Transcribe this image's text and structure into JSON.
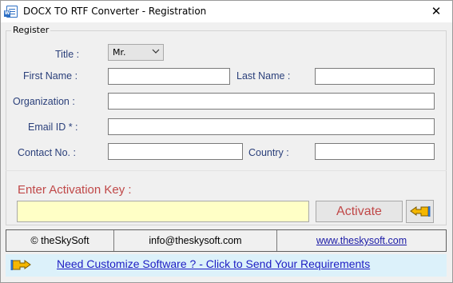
{
  "window": {
    "title": "DOCX TO RTF Converter - Registration",
    "close_glyph": "✕"
  },
  "register": {
    "group_label": "Register",
    "title_label": "Title :",
    "title_value": "Mr.",
    "first_name_label": "First Name :",
    "last_name_label": "Last Name :",
    "organization_label": "Organization :",
    "email_label": "Email ID * :",
    "contact_label": "Contact No. :",
    "country_label": "Country :",
    "first_name_value": "",
    "last_name_value": "",
    "organization_value": "",
    "email_value": "",
    "contact_value": "",
    "country_value": ""
  },
  "activation": {
    "label": "Enter Activation Key  :",
    "key_value": "",
    "button_label": "Activate",
    "back_icon": "hand-pointing-left-icon"
  },
  "footer": {
    "company": "© theSkySoft",
    "email": "info@theskysoft.com",
    "website": "www.theskysoft.com"
  },
  "bottom": {
    "link_text": "Need Customize Software ? - Click to Send Your Requirements",
    "icon": "hand-pointing-right-icon"
  },
  "colors": {
    "label_blue": "#2a3f7a",
    "activation_red": "#c04848",
    "key_input_bg": "#ffffc6",
    "bottom_bar_bg": "#dcf1fa",
    "link_blue": "#1d1dc4"
  }
}
